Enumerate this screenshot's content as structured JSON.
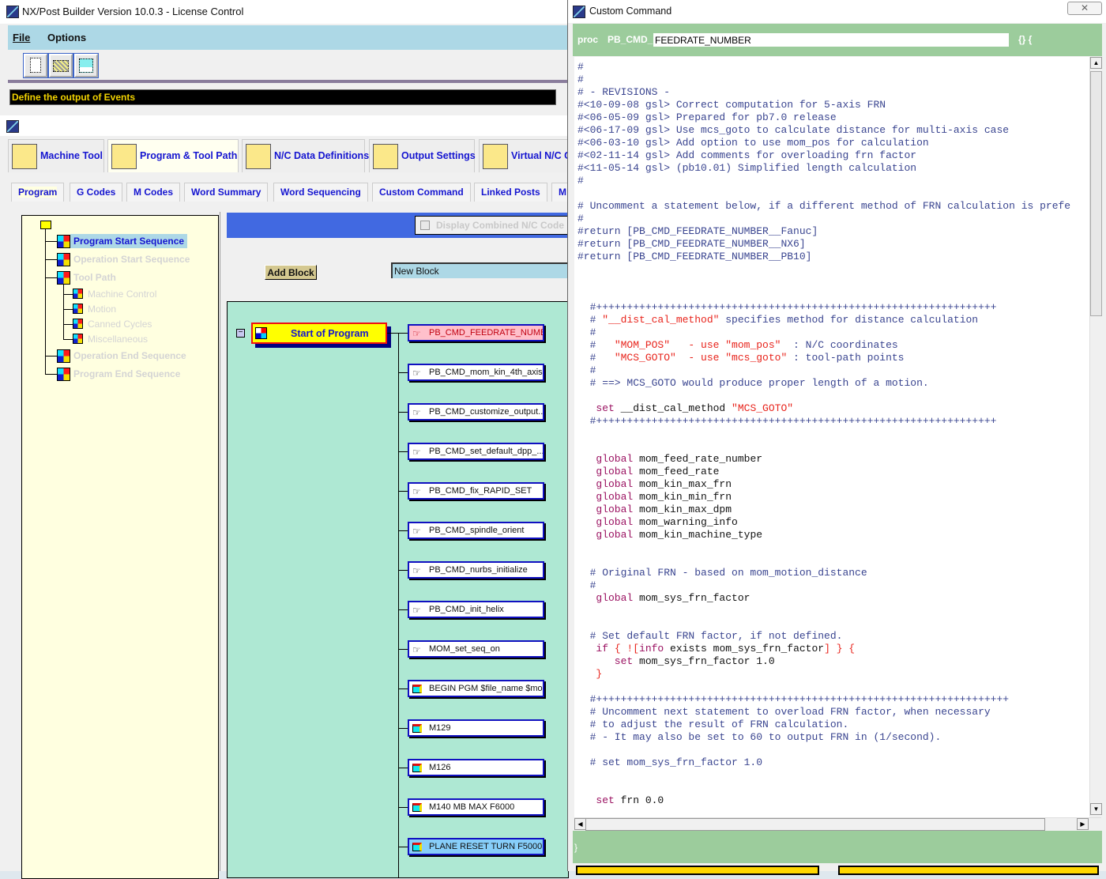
{
  "main_window": {
    "title": "NX/Post Builder Version 10.0.3 - License Control",
    "menu": [
      "File",
      "Options"
    ],
    "toolbar": [
      {
        "icon": "new-file-icon"
      },
      {
        "icon": "open-folder-icon"
      },
      {
        "icon": "save-icon"
      }
    ],
    "status": "Define the output of Events"
  },
  "main_tabs": [
    {
      "label": "Machine Tool",
      "icon": "machine-tool-icon"
    },
    {
      "label": "Program & Tool Path",
      "icon": "program-toolpath-icon",
      "selected": true
    },
    {
      "label": "N/C Data Definitions",
      "icon": "nc-data-icon"
    },
    {
      "label": "Output Settings",
      "icon": "printer-icon"
    },
    {
      "label": "Virtual N/C C",
      "icon": "virtual-nc-icon"
    }
  ],
  "sub_tabs": [
    {
      "label": "Program",
      "selected": true
    },
    {
      "label": "G Codes"
    },
    {
      "label": "M Codes"
    },
    {
      "label": "Word Summary"
    },
    {
      "label": "Word Sequencing"
    },
    {
      "label": "Custom Command"
    },
    {
      "label": "Linked Posts"
    },
    {
      "label": "M"
    }
  ],
  "tree": {
    "items": [
      {
        "label": "Program Start Sequence",
        "selected": true
      },
      {
        "label": "Operation Start Sequence"
      },
      {
        "label": "Tool Path"
      },
      {
        "label": "Machine Control",
        "child": true
      },
      {
        "label": "Motion",
        "child": true
      },
      {
        "label": "Canned Cycles",
        "child": true
      },
      {
        "label": "Miscellaneous",
        "child": true
      },
      {
        "label": "Operation End Sequence"
      },
      {
        "label": "Program End Sequence"
      }
    ]
  },
  "editor": {
    "display_combined_label": "Display Combined N/C Code B",
    "display_combined_checked": false,
    "add_block_label": "Add Block",
    "new_block_value": "New Block",
    "event_label": "Start of Program",
    "blocks": [
      {
        "label": "PB_CMD_FEEDRATE_NUMB...",
        "type": "command",
        "state": "selected"
      },
      {
        "label": "PB_CMD_mom_kin_4th_axis...",
        "type": "command"
      },
      {
        "label": "PB_CMD_customize_output...",
        "type": "command"
      },
      {
        "label": "PB_CMD_set_default_dpp_...",
        "type": "command"
      },
      {
        "label": "PB_CMD_fix_RAPID_SET",
        "type": "command"
      },
      {
        "label": "PB_CMD_spindle_orient",
        "type": "command"
      },
      {
        "label": "PB_CMD_nurbs_initialize",
        "type": "command"
      },
      {
        "label": "PB_CMD_init_helix",
        "type": "command"
      },
      {
        "label": "MOM_set_seq_on",
        "type": "command"
      },
      {
        "label": "BEGIN PGM $file_name $mo...",
        "type": "block"
      },
      {
        "label": "M129",
        "type": "block"
      },
      {
        "label": "M126",
        "type": "block"
      },
      {
        "label": "M140 MB MAX F6000",
        "type": "block"
      },
      {
        "label": "PLANE RESET TURN F5000",
        "type": "block",
        "state": "highlighted"
      }
    ]
  },
  "dialog": {
    "title": "Custom Command",
    "close": "✕",
    "proc_label": "proc",
    "prefix": "PB_CMD_",
    "name": "FEEDRATE_NUMBER",
    "brace_label": "{} {",
    "closing_brace": "}",
    "code": [
      [
        [
          "c",
          "#"
        ]
      ],
      [
        [
          "c",
          "#"
        ]
      ],
      [
        [
          "c",
          "# - REVISIONS -"
        ]
      ],
      [
        [
          "c",
          "#<10-09-08 gsl> Correct computation for 5-axis FRN"
        ]
      ],
      [
        [
          "c",
          "#<06-05-09 gsl> Prepared for pb7.0 release"
        ]
      ],
      [
        [
          "c",
          "#<06-17-09 gsl> Use mcs_goto to calculate distance for multi-axis case"
        ]
      ],
      [
        [
          "c",
          "#<06-03-10 gsl> Add option to use mom_pos for calculation"
        ]
      ],
      [
        [
          "c",
          "#<02-11-14 gsl> Add comments for overloading frn factor"
        ]
      ],
      [
        [
          "c",
          "#<11-05-14 gsl> (pb10.01) Simplified length calculation"
        ]
      ],
      [
        [
          "c",
          "#"
        ]
      ],
      [],
      [
        [
          "c",
          "# Uncomment a statement below, if a different method of FRN calculation is prefe"
        ]
      ],
      [
        [
          "c",
          "#"
        ]
      ],
      [
        [
          "c",
          "#return [PB_CMD_FEEDRATE_NUMBER__Fanuc]"
        ]
      ],
      [
        [
          "c",
          "#return [PB_CMD_FEEDRATE_NUMBER__NX6]"
        ]
      ],
      [
        [
          "c",
          "#return [PB_CMD_FEEDRATE_NUMBER__PB10]"
        ]
      ],
      [],
      [],
      [],
      [
        [
          "c",
          "  #+++++++++++++++++++++++++++++++++++++++++++++++++++++++++++++++++"
        ]
      ],
      [
        [
          "c",
          "  # "
        ],
        [
          "s",
          "\"__dist_cal_method\""
        ],
        [
          "c",
          " specifies method for distance calculation"
        ]
      ],
      [
        [
          "c",
          "  #"
        ]
      ],
      [
        [
          "c",
          "  #   "
        ],
        [
          "s",
          "\"MOM_POS\"   - use \"mom_pos\""
        ],
        [
          "c",
          "  : N/C coordinates"
        ]
      ],
      [
        [
          "c",
          "  #   "
        ],
        [
          "s",
          "\"MCS_GOTO\"  - use \"mcs_goto\""
        ],
        [
          "c",
          " : tool-path points"
        ]
      ],
      [
        [
          "c",
          "  #"
        ]
      ],
      [
        [
          "c",
          "  # ==> MCS_GOTO would produce proper length of a motion."
        ]
      ],
      [],
      [
        [
          "k",
          "   set"
        ],
        [
          "n",
          " __dist_cal_method "
        ],
        [
          "s",
          "\"MCS_GOTO\""
        ]
      ],
      [
        [
          "c",
          "  #+++++++++++++++++++++++++++++++++++++++++++++++++++++++++++++++++"
        ]
      ],
      [],
      [],
      [
        [
          "k",
          "   global"
        ],
        [
          "n",
          " mom_feed_rate_number"
        ]
      ],
      [
        [
          "k",
          "   global"
        ],
        [
          "n",
          " mom_feed_rate"
        ]
      ],
      [
        [
          "k",
          "   global"
        ],
        [
          "n",
          " mom_kin_max_frn"
        ]
      ],
      [
        [
          "k",
          "   global"
        ],
        [
          "n",
          " mom_kin_min_frn"
        ]
      ],
      [
        [
          "k",
          "   global"
        ],
        [
          "n",
          " mom_kin_max_dpm"
        ]
      ],
      [
        [
          "k",
          "   global"
        ],
        [
          "n",
          " mom_warning_info"
        ]
      ],
      [
        [
          "k",
          "   global"
        ],
        [
          "n",
          " mom_kin_machine_type"
        ]
      ],
      [],
      [],
      [
        [
          "c",
          "  # Original FRN - based on mom_motion_distance"
        ]
      ],
      [
        [
          "c",
          "  #"
        ]
      ],
      [
        [
          "k",
          "   global"
        ],
        [
          "n",
          " mom_sys_frn_factor"
        ]
      ],
      [],
      [],
      [
        [
          "c",
          "  # Set default FRN factor, if not defined."
        ]
      ],
      [
        [
          "k",
          "   if"
        ],
        [
          "s",
          " { !["
        ],
        [
          "k",
          "info"
        ],
        [
          "n",
          " exists mom_sys_frn_factor"
        ],
        [
          "s",
          "] } {"
        ]
      ],
      [
        [
          "k",
          "      set"
        ],
        [
          "n",
          " mom_sys_frn_factor 1.0"
        ]
      ],
      [
        [
          "s",
          "   }"
        ]
      ],
      [],
      [
        [
          "c",
          "  #+++++++++++++++++++++++++++++++++++++++++++++++++++++++++++++++++++"
        ]
      ],
      [
        [
          "c",
          "  # Uncomment next statement to overload FRN factor, when necessary"
        ]
      ],
      [
        [
          "c",
          "  # to adjust the result of FRN calculation."
        ]
      ],
      [
        [
          "c",
          "  # - It may also be set to 60 to output FRN in (1/second)."
        ]
      ],
      [],
      [
        [
          "c",
          "  # set mom_sys_frn_factor 1.0"
        ]
      ],
      [],
      [],
      [
        [
          "k",
          "   set"
        ],
        [
          "n",
          " frn 0.0"
        ]
      ]
    ]
  },
  "colors": {
    "menu_bar": "#add8e6",
    "status_text": "#f2d300",
    "tab_text": "#1515d0",
    "tree_bg": "#ffffe0",
    "event_bar": "#4169e1",
    "sequence_bg": "#aee8d3",
    "event_button": "#ffff00",
    "dialog_header": "#9ccc9c",
    "comment": "#3a4590",
    "string": "#e8241c",
    "keyword": "#9a1060"
  }
}
